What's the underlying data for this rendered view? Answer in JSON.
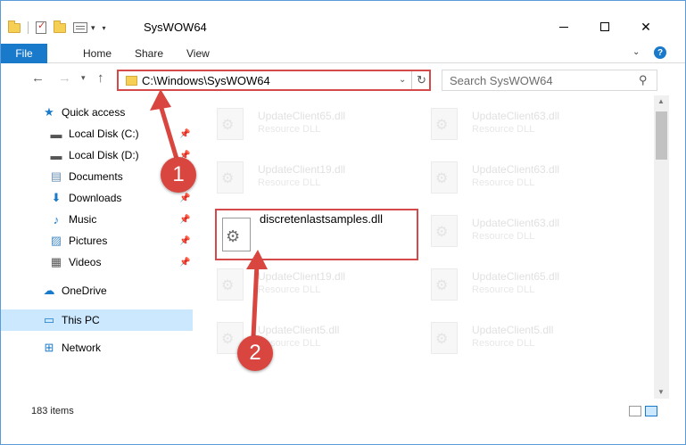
{
  "window": {
    "title": "SysWOW64"
  },
  "ribbon": {
    "tabs": [
      "File",
      "Home",
      "Share",
      "View"
    ]
  },
  "address": {
    "path": "C:\\Windows\\SysWOW64"
  },
  "search": {
    "placeholder": "Search SysWOW64"
  },
  "sidebar": {
    "items": [
      {
        "label": "Quick access",
        "icon": "star-icon"
      },
      {
        "label": "Local Disk (C:)",
        "icon": "drive-icon"
      },
      {
        "label": "Local Disk (D:)",
        "icon": "drive-icon"
      },
      {
        "label": "Documents",
        "icon": "documents-icon"
      },
      {
        "label": "Downloads",
        "icon": "download-icon"
      },
      {
        "label": "Music",
        "icon": "music-icon"
      },
      {
        "label": "Pictures",
        "icon": "pictures-icon"
      },
      {
        "label": "Videos",
        "icon": "videos-icon"
      },
      {
        "label": "OneDrive",
        "icon": "cloud-icon"
      },
      {
        "label": "This PC",
        "icon": "computer-icon"
      },
      {
        "label": "Network",
        "icon": "network-icon"
      }
    ]
  },
  "files": [
    {
      "name": "UpdateClient65.dll",
      "type": "Resource DLL"
    },
    {
      "name": "UpdateClient63.dll",
      "type": "Resource DLL"
    },
    {
      "name": "UpdateClient19.dll",
      "type": "Resource DLL"
    },
    {
      "name": "UpdateClient63.dll",
      "type": "Resource DLL"
    },
    {
      "name": "UpdateClient63.dll",
      "type": "Resource DLL"
    },
    {
      "name": "UpdateClient19.dll",
      "type": "Resource DLL"
    },
    {
      "name": "UpdateClient65.dll",
      "type": "Resource DLL"
    },
    {
      "name": "UpdateClient5.dll",
      "type": "Resource DLL"
    },
    {
      "name": "UpdateClient5.dll",
      "type": "Resource DLL"
    }
  ],
  "highlighted_file": {
    "name": "discretenlastsamples.dll"
  },
  "status": {
    "count": "183 items"
  },
  "callouts": [
    "1",
    "2"
  ],
  "colors": {
    "accent": "#1979ca",
    "callout": "#d9453f",
    "selection": "#cce8ff"
  }
}
